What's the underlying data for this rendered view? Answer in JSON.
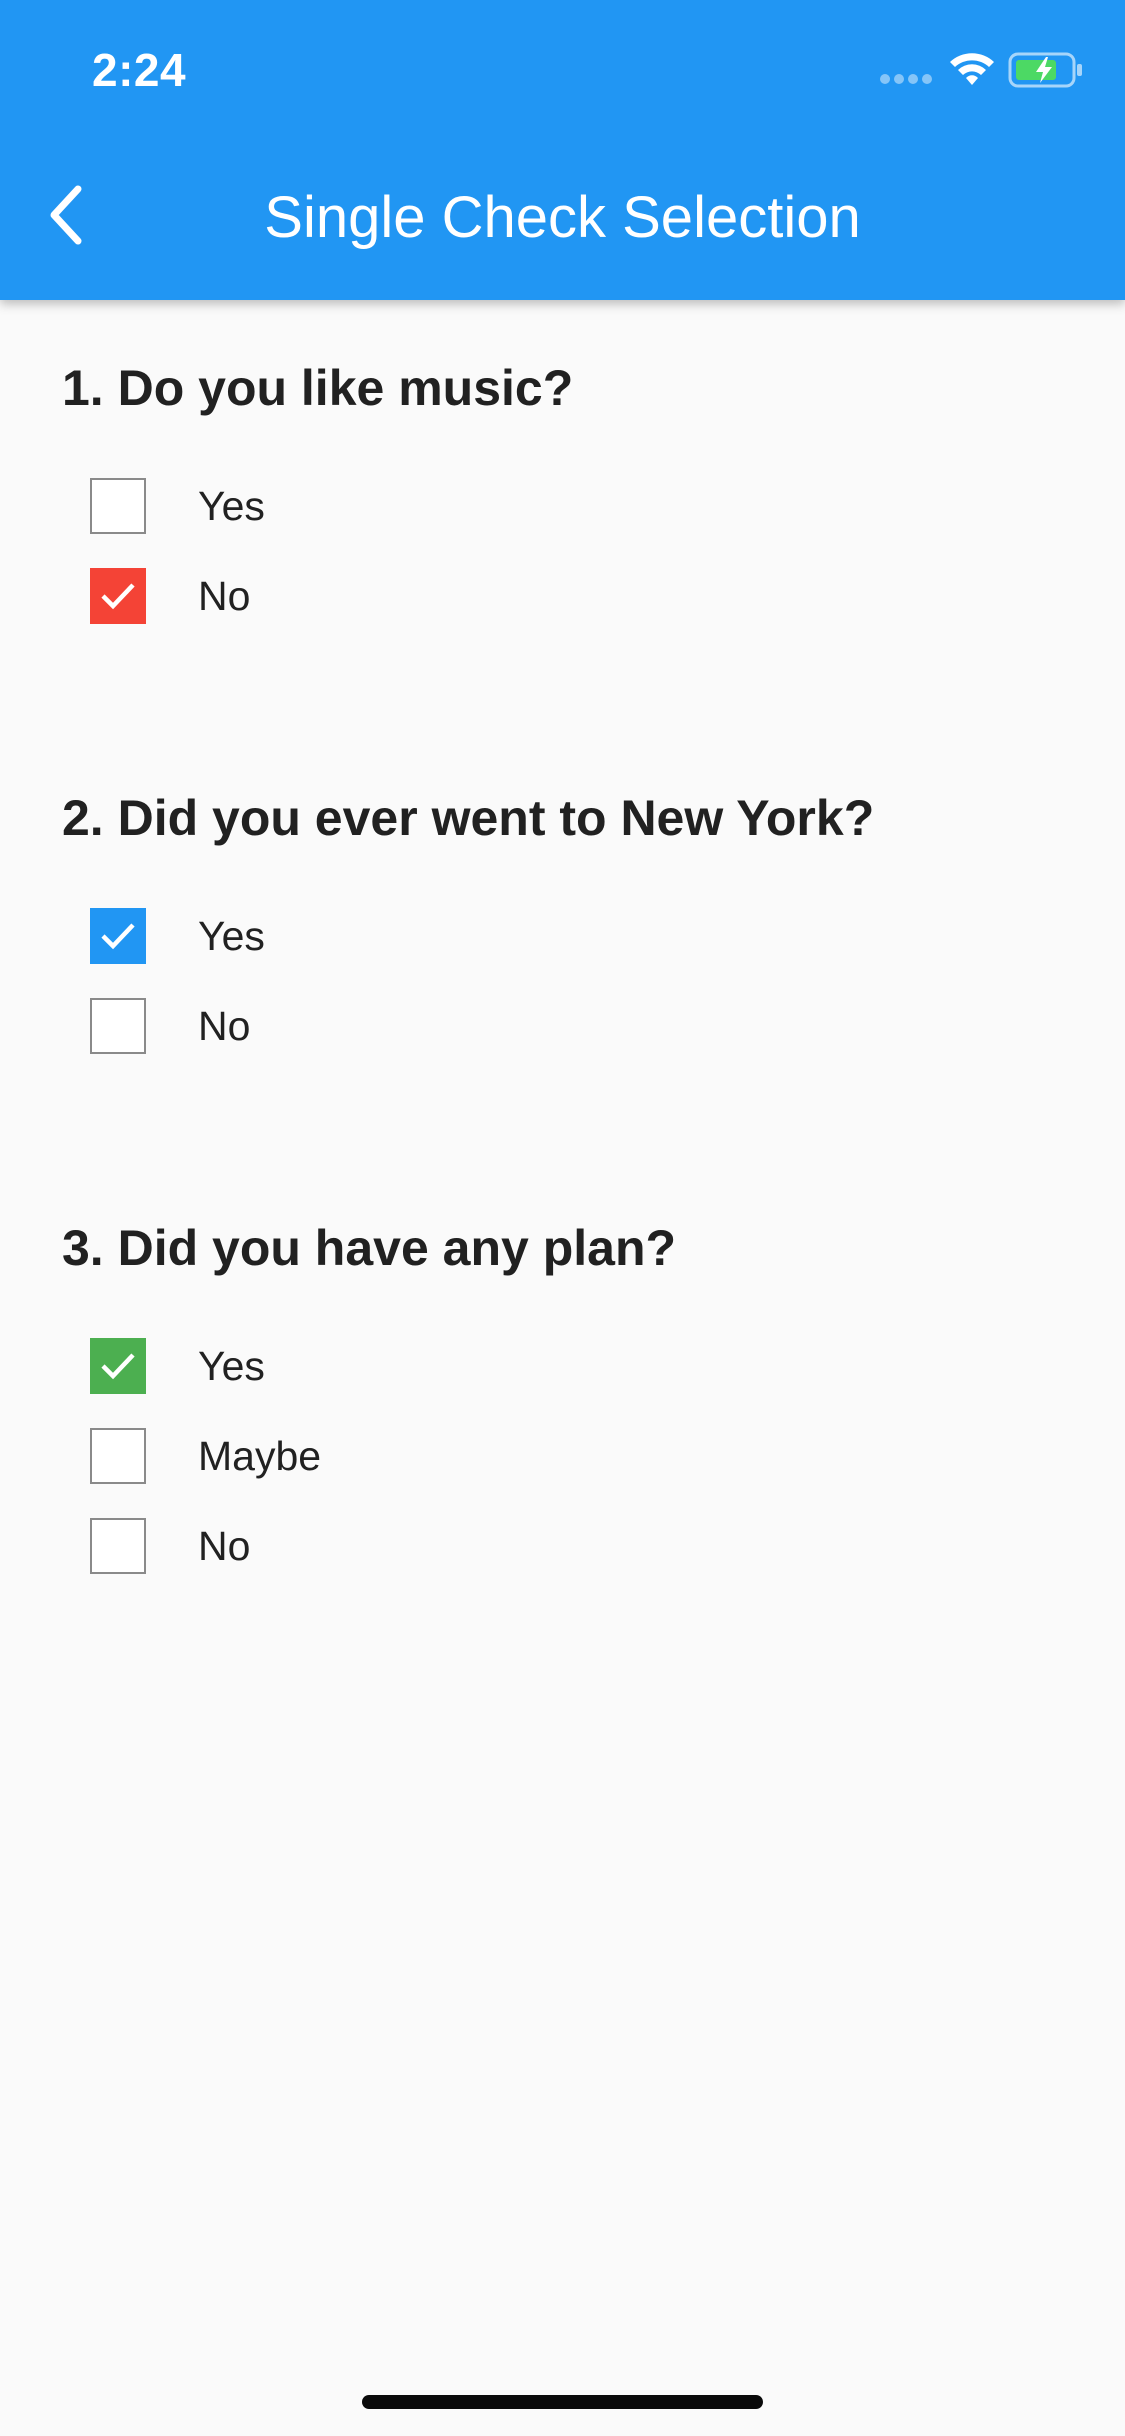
{
  "status_bar": {
    "time": "2:24",
    "wifi_icon": "wifi-icon",
    "battery_icon": "battery-charging-icon",
    "battery_color": "#4cd964"
  },
  "app_bar": {
    "title": "Single Check Selection",
    "back_icon": "chevron-left-icon",
    "background": "#2196f3"
  },
  "questions": [
    {
      "label": "1. Do you like music?",
      "accent": "#f44336",
      "options": [
        {
          "label": "Yes",
          "checked": false
        },
        {
          "label": "No",
          "checked": true
        }
      ]
    },
    {
      "label": "2. Did you ever went to New York?",
      "accent": "#2196f3",
      "options": [
        {
          "label": "Yes",
          "checked": true
        },
        {
          "label": "No",
          "checked": false
        }
      ]
    },
    {
      "label": "3. Did you have any plan?",
      "accent": "#4caf50",
      "options": [
        {
          "label": "Yes",
          "checked": true
        },
        {
          "label": "Maybe",
          "checked": false
        },
        {
          "label": "No",
          "checked": false
        }
      ]
    }
  ]
}
